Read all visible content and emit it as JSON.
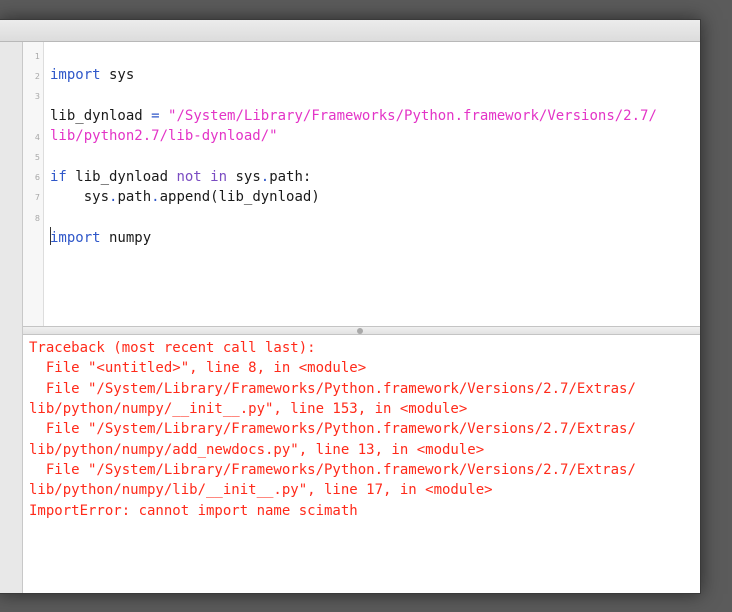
{
  "editor": {
    "line_numbers": [
      "1",
      "2",
      "3",
      "4",
      "5",
      "6",
      "7",
      "8"
    ],
    "line1": {
      "kw": "import",
      "rest": " sys"
    },
    "line3": {
      "name": "lib_dynload ",
      "op": "=",
      "sp": " ",
      "str": "\"/System/Library/Frameworks/Python.framework/Versions/2.7/"
    },
    "line3_cont": {
      "str": "lib/python2.7/lib-dynload/\""
    },
    "line5": {
      "kw": "if",
      "a": " lib_dynload ",
      "not": "not",
      "sp": " ",
      "in": "in",
      "b": " sys",
      "dot": ".",
      "c": "path:"
    },
    "line6": {
      "a": "    sys",
      "dot1": ".",
      "b": "path",
      "dot2": ".",
      "c": "append(lib_dynload)"
    },
    "line8": {
      "kw": "import",
      "rest": " numpy"
    }
  },
  "output": {
    "lines": [
      "Traceback (most recent call last):",
      "  File \"<untitled>\", line 8, in <module>",
      "  File \"/System/Library/Frameworks/Python.framework/Versions/2.7/Extras/",
      "lib/python/numpy/__init__.py\", line 153, in <module>",
      "  File \"/System/Library/Frameworks/Python.framework/Versions/2.7/Extras/",
      "lib/python/numpy/add_newdocs.py\", line 13, in <module>",
      "  File \"/System/Library/Frameworks/Python.framework/Versions/2.7/Extras/",
      "lib/python/numpy/lib/__init__.py\", line 17, in <module>",
      "ImportError: cannot import name scimath"
    ]
  },
  "colors": {
    "keyword": "#2f57c9",
    "keyword_operator": "#7a4cc2",
    "string": "#e334c7",
    "error_text": "#ff2a1a",
    "desktop": "#5b5b5b"
  }
}
